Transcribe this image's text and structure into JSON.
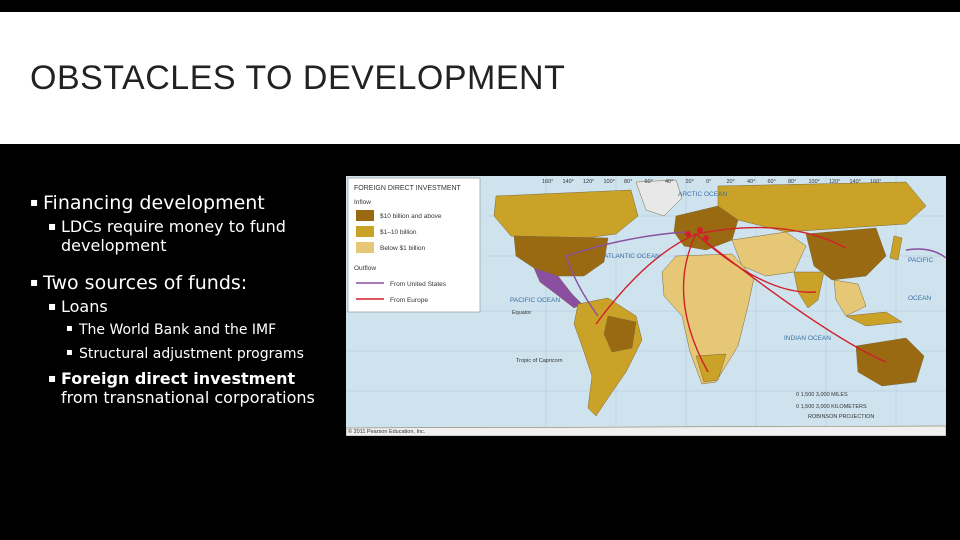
{
  "slide": {
    "title": "OBSTACLES TO DEVELOPMENT",
    "bullets": {
      "b1": "Financing development",
      "b1_sub": "LDCs require money to fund development",
      "b2": "Two sources of funds:",
      "b2_loans": "Loans",
      "b2_loans_1": "The World Bank and the IMF",
      "b2_loans_2": "Structural adjustment programs",
      "b2_fdi_bold": "Foreign direct investment",
      "b2_fdi_rest": " from transnational corporations"
    }
  },
  "map": {
    "legend_title": "FOREIGN DIRECT INVESTMENT",
    "inflow_label": "Inflow",
    "inflow_items": [
      "$10 billion and above",
      "$1–10 billion",
      "Below $1 billion"
    ],
    "outflow_label": "Outflow",
    "outflow_items": [
      "From United States",
      "From Europe"
    ],
    "oceans": {
      "arctic": "ARCTIC OCEAN",
      "atlantic": "ATLANTIC OCEAN",
      "pacific_w": "PACIFIC OCEAN",
      "pacific_e": "PACIFIC",
      "ocean_e": "OCEAN",
      "indian": "INDIAN OCEAN"
    },
    "labels": {
      "equator": "Equator",
      "capricorn": "Tropic of Capricorn",
      "scale1": "0    1,500     3,000 MILES",
      "scale2": "0   1,500   3,000 KILOMETERS",
      "projection": "ROBINSON PROJECTION",
      "copyright": "© 2011 Pearson Education, Inc."
    },
    "top_ticks": [
      "160°",
      "140°",
      "120°",
      "100°",
      "80°",
      "60°",
      "40°",
      "20°",
      "0°",
      "20°",
      "40°",
      "60°",
      "80°",
      "100°",
      "120°",
      "140°",
      "160°"
    ],
    "colors": {
      "ocean": "#cfe3ef",
      "high": "#9a6a12",
      "mid": "#c9a227",
      "low": "#e6c776",
      "us_arrow": "#8a4fa0",
      "eu_arrow": "#d0202a"
    }
  }
}
